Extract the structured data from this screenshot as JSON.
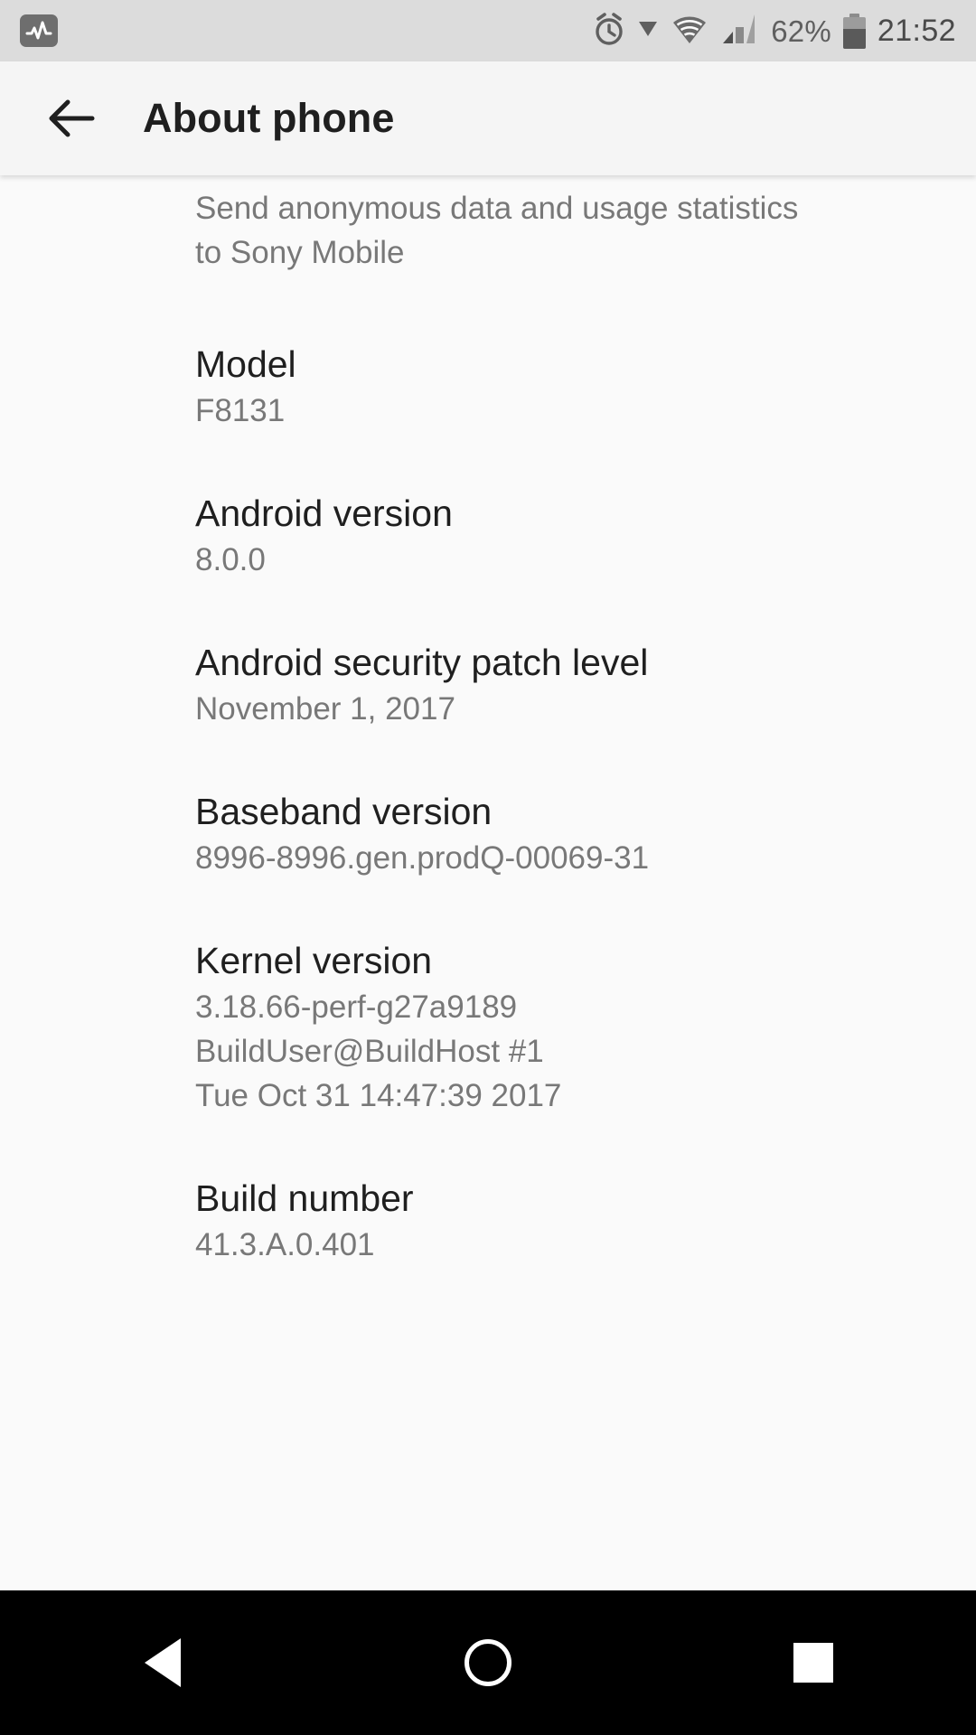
{
  "status_bar": {
    "notification_icon": "activity-graph-icon",
    "alarm_icon": "alarm-clock-icon",
    "data_arrow_icon": "download-triangle-icon",
    "wifi_icon": "wifi-icon",
    "signal_icon": "cellular-signal-icon",
    "battery_percent": "62%",
    "battery_level": 62,
    "battery_icon": "battery-icon",
    "clock": "21:52"
  },
  "app_bar": {
    "back_label": "back-arrow",
    "title": "About phone"
  },
  "list": {
    "clipped_item": {
      "subtitle_line_1": "Send anonymous data and usage statistics",
      "subtitle_line_2": "to Sony Mobile"
    },
    "items": [
      {
        "title": "Model",
        "value": "F8131"
      },
      {
        "title": "Android version",
        "value": "8.0.0"
      },
      {
        "title": "Android security patch level",
        "value": "November 1, 2017"
      },
      {
        "title": "Baseband version",
        "value": "8996-8996.gen.prodQ-00069-31"
      },
      {
        "title": "Kernel version",
        "value_line_1": "3.18.66-perf-g27a9189",
        "value_line_2": "BuildUser@BuildHost #1",
        "value_line_3": "Tue Oct 31 14:47:39 2017"
      },
      {
        "title": "Build number",
        "value": "41.3.A.0.401"
      }
    ]
  },
  "nav_bar": {
    "back": "back-triangle",
    "home": "home-circle",
    "recents": "recents-square"
  }
}
